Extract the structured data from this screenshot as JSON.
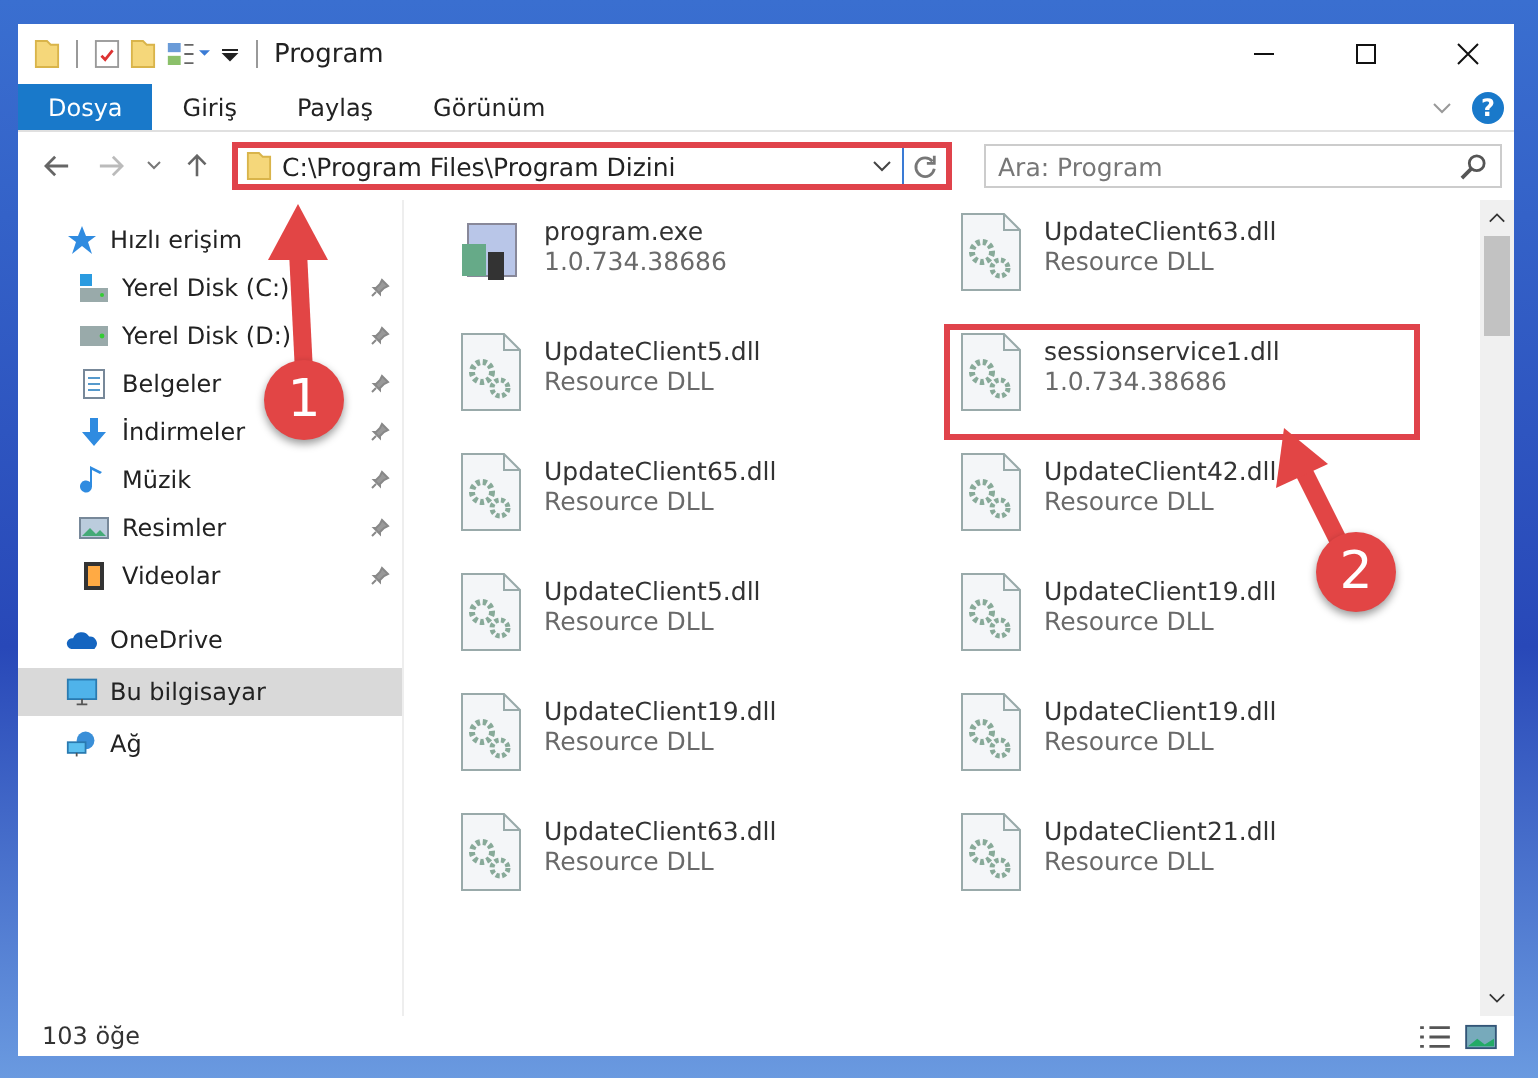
{
  "window": {
    "title": "Program"
  },
  "ribbon_tabs": [
    {
      "label": "Dosya",
      "selected": true
    },
    {
      "label": "Giriş",
      "selected": false
    },
    {
      "label": "Paylaş",
      "selected": false
    },
    {
      "label": "Görünüm",
      "selected": false
    }
  ],
  "help": "?",
  "address": {
    "value": "C:\\Program Files\\Program Dizini",
    "highlighted": true
  },
  "search": {
    "placeholder": "Ara: Program"
  },
  "nav": [
    {
      "label": "Hızlı erişim",
      "selected": false,
      "children": [
        {
          "label": "Yerel Disk (C:)",
          "pinned": true
        },
        {
          "label": "Yerel Disk (D:)",
          "pinned": true
        },
        {
          "label": "Belgeler",
          "pinned": true
        },
        {
          "label": "İndirmeler",
          "pinned": true
        },
        {
          "label": "Müzik",
          "pinned": true
        },
        {
          "label": "Resimler",
          "pinned": true
        },
        {
          "label": "Videolar",
          "pinned": true
        }
      ]
    },
    {
      "label": "OneDrive",
      "selected": false
    },
    {
      "label": "Bu bilgisayar",
      "selected": true
    },
    {
      "label": "Ağ",
      "selected": false
    }
  ],
  "files": [
    {
      "name": "program.exe",
      "detail": "1.0.734.38686",
      "kind": "exe",
      "highlighted": false
    },
    {
      "name": "UpdateClient63.dll",
      "detail": "Resource DLL",
      "kind": "dll",
      "highlighted": false
    },
    {
      "name": "UpdateClient5.dll",
      "detail": "Resource DLL",
      "kind": "dll",
      "highlighted": false
    },
    {
      "name": "sessionservice1.dll",
      "detail": "1.0.734.38686",
      "kind": "dll",
      "highlighted": true
    },
    {
      "name": "UpdateClient65.dll",
      "detail": "Resource DLL",
      "kind": "dll",
      "highlighted": false
    },
    {
      "name": "UpdateClient42.dll",
      "detail": "Resource DLL",
      "kind": "dll",
      "highlighted": false
    },
    {
      "name": "UpdateClient5.dll",
      "detail": "Resource DLL",
      "kind": "dll",
      "highlighted": false
    },
    {
      "name": "UpdateClient19.dll",
      "detail": "Resource DLL",
      "kind": "dll",
      "highlighted": false
    },
    {
      "name": "UpdateClient19.dll",
      "detail": "Resource DLL",
      "kind": "dll",
      "highlighted": false
    },
    {
      "name": "UpdateClient19.dll",
      "detail": "Resource DLL",
      "kind": "dll",
      "highlighted": false
    },
    {
      "name": "UpdateClient63.dll",
      "detail": "Resource DLL",
      "kind": "dll",
      "highlighted": false
    },
    {
      "name": "UpdateClient21.dll",
      "detail": "Resource DLL",
      "kind": "dll",
      "highlighted": false
    }
  ],
  "status_bar": {
    "count": "103 öğe"
  },
  "annotations": [
    {
      "label": "1"
    },
    {
      "label": "2"
    }
  ]
}
